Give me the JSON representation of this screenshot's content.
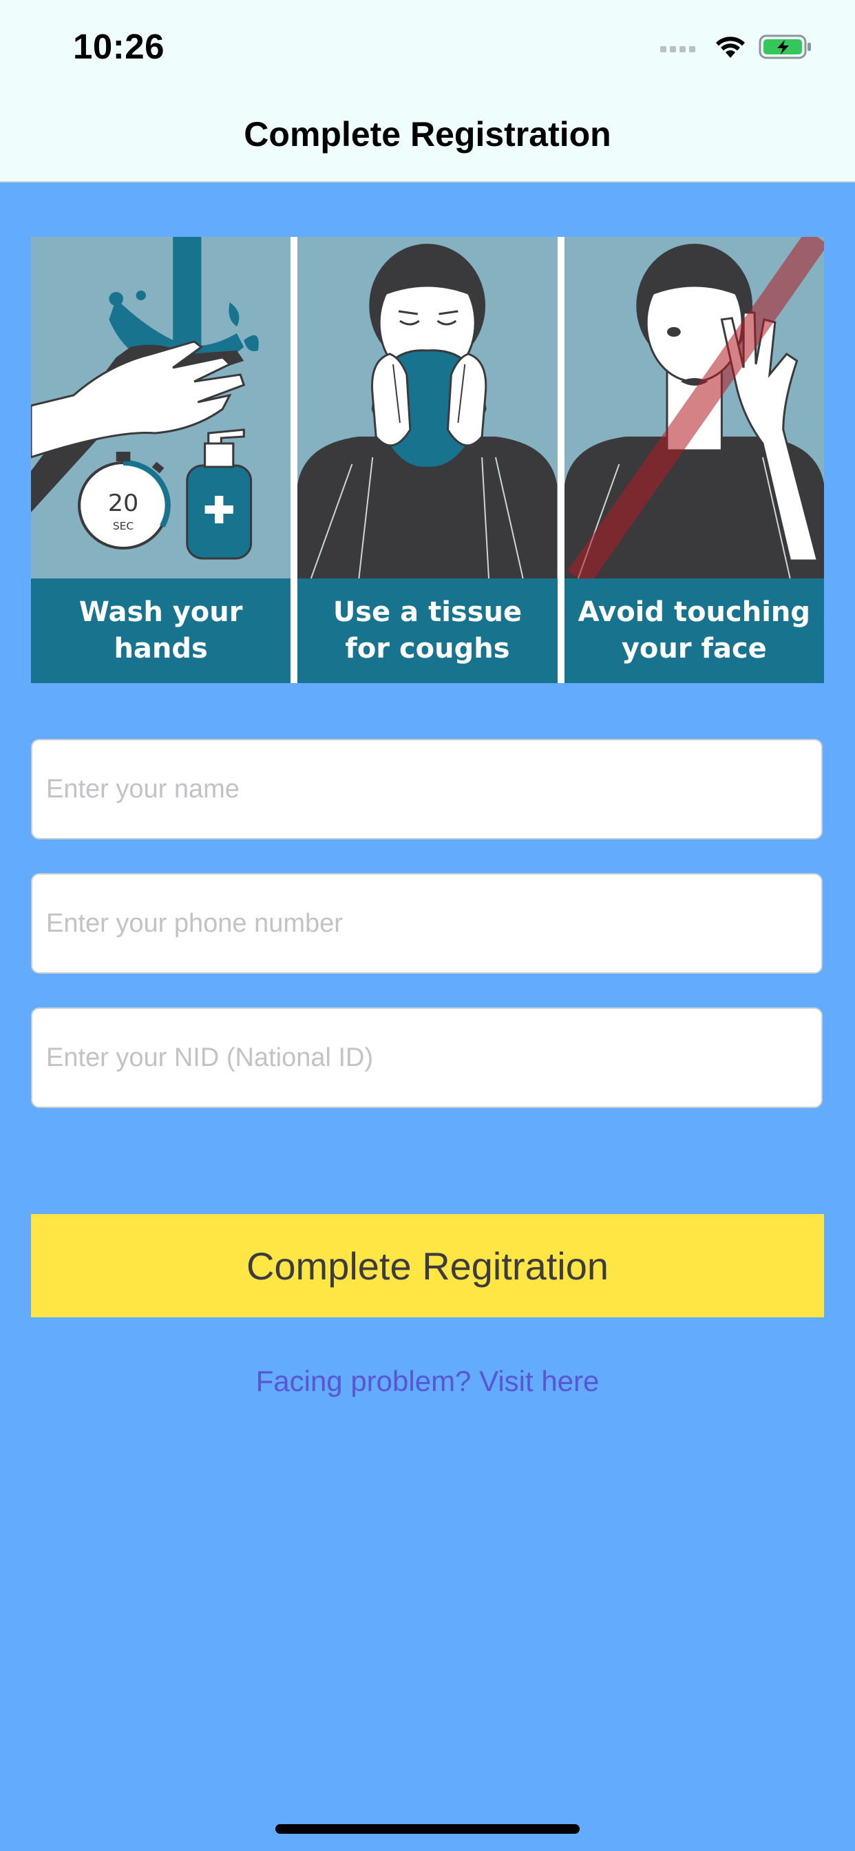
{
  "status_bar": {
    "time": "10:26"
  },
  "nav": {
    "title": "Complete Registration"
  },
  "banner": {
    "panels": [
      {
        "caption": "Wash your\nhands",
        "timer_number": "20",
        "timer_unit": "SEC"
      },
      {
        "caption": "Use a tissue\nfor coughs"
      },
      {
        "caption": "Avoid touching\nyour face"
      }
    ]
  },
  "form": {
    "name_placeholder": "Enter your name",
    "phone_placeholder": "Enter your phone number",
    "nid_placeholder": "Enter your NID (National ID)",
    "submit_label": "Complete Regitration",
    "help_link": "Facing problem? Visit here"
  },
  "colors": {
    "background": "#63abfd",
    "button": "#ffe645",
    "link": "#5856d6",
    "banner_caption": "#18738f"
  },
  "icons": [
    "signal-dots-icon",
    "wifi-icon",
    "battery-charging-icon"
  ]
}
